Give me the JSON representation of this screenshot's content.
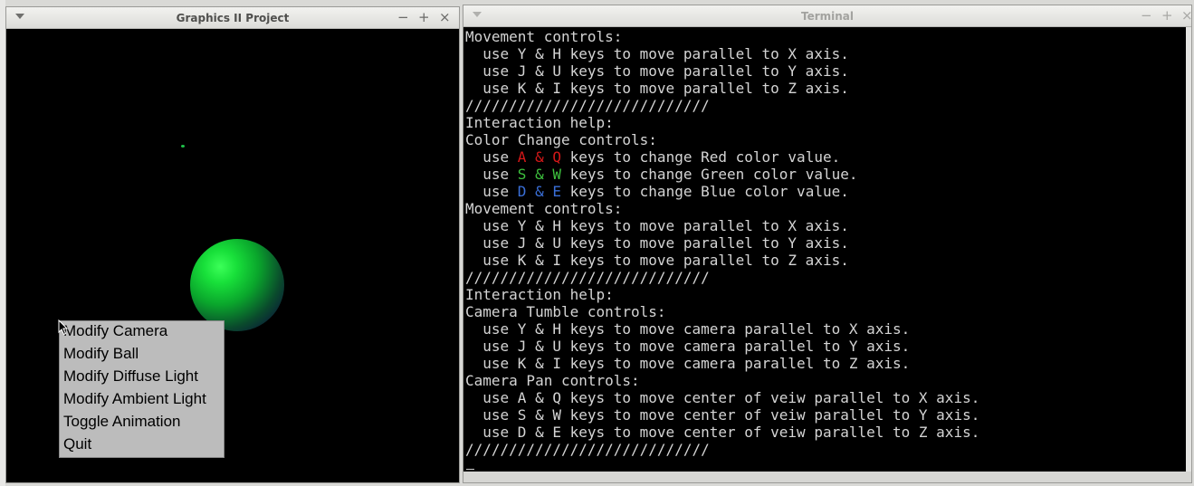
{
  "graphics_window": {
    "title": "Graphics II Project",
    "controls": {
      "minimize": "−",
      "maximize": "+",
      "close": "×"
    },
    "context_menu": [
      "Modify Camera",
      "Modify Ball",
      "Modify Diffuse Light",
      "Modify Ambient Light",
      "Toggle Animation",
      "Quit"
    ]
  },
  "terminal_window": {
    "title": "Terminal",
    "controls": {
      "minimize": "−",
      "maximize": "+",
      "close": "×"
    },
    "lines": [
      "Movement controls:",
      "  use Y & H keys to move parallel to X axis.",
      "  use J & U keys to move parallel to Y axis.",
      "  use K & I keys to move parallel to Z axis.",
      "////////////////////////////",
      "Interaction help:",
      "Color Change controls:",
      {
        "pre": "  use ",
        "keys": "A & Q",
        "color": "#d41818",
        "post": " keys to change Red color value."
      },
      {
        "pre": "  use ",
        "keys": "S & W",
        "color": "#3ec13e",
        "post": " keys to change Green color value."
      },
      {
        "pre": "  use ",
        "keys": "D & E",
        "color": "#3a6fd8",
        "post": " keys to change Blue color value."
      },
      "Movement controls:",
      "  use Y & H keys to move parallel to X axis.",
      "  use J & U keys to move parallel to Y axis.",
      "  use K & I keys to move parallel to Z axis.",
      "////////////////////////////",
      "Interaction help:",
      "Camera Tumble controls:",
      "  use Y & H keys to move camera parallel to X axis.",
      "  use J & U keys to move camera parallel to Y axis.",
      "  use K & I keys to move camera parallel to Z axis.",
      "Camera Pan controls:",
      "  use A & Q keys to move center of veiw parallel to X axis.",
      "  use S & W keys to move center of veiw parallel to Y axis.",
      "  use D & E keys to move center of veiw parallel to Z axis.",
      "////////////////////////////"
    ],
    "prompt_cursor": "_"
  },
  "colors": {
    "red_keys": "#d41818",
    "green_keys": "#3ec13e",
    "blue_keys": "#3a6fd8",
    "sphere_green": "#18e03a",
    "sphere_shadow": "#0b1a3a"
  }
}
